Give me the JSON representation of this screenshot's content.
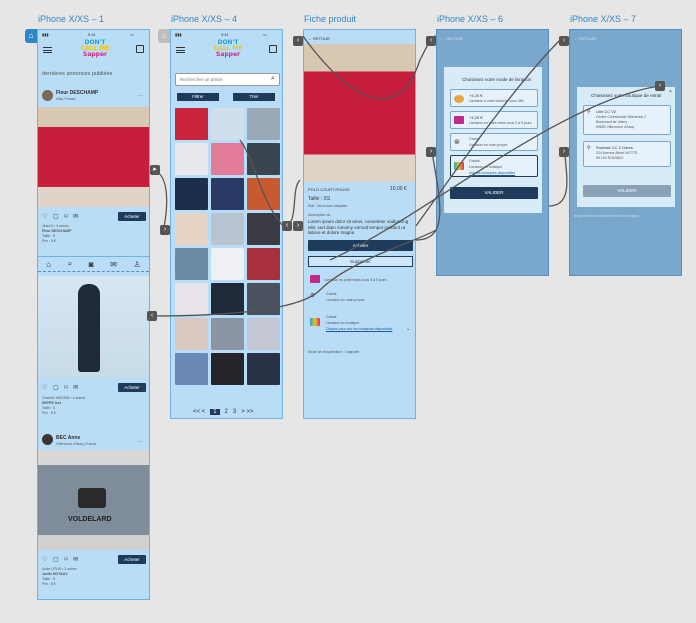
{
  "artboards": {
    "a1": "iPhone X/XS – 1",
    "a4": "iPhone X/XS – 4",
    "fp": "Fiche produit",
    "a6": "iPhone X/XS – 6",
    "a7": "iPhone X/XS – 7"
  },
  "logo": {
    "l1": "DON'T",
    "l2": "CALL ME",
    "l3": "Sapper"
  },
  "feed": {
    "heading": "dernières annonces publiées",
    "post1": {
      "name": "Fleur DESCHAMP",
      "location": "Villa, France",
      "meta1": "Jean D • 4 autres",
      "meta2": "Fleur DESCHAMP",
      "meta3": "Taille : S",
      "meta4": "Prix : 8 €",
      "buy": "Acheter"
    },
    "post2": {
      "meta1": "Charline MASSIN • 4 autres",
      "meta2": "SEPPE test",
      "meta3": "Taille : S",
      "meta4": "Prix : 8 €",
      "buy": "Acheter"
    },
    "post3": {
      "name": "BEC Anne",
      "location": "Villeneuve d'Ascq, France",
      "meta1": "Aude LEVIS • 3 autres",
      "meta2": "Joelle NOYAUX",
      "meta3": "Taille : S",
      "meta4": "Prix : 8 €",
      "buy": "Acheter",
      "print": "VOLDELARD"
    }
  },
  "catalog": {
    "search_placeholder": "Rechercher un article",
    "filter": "Filtrer",
    "sort": "Trier",
    "pager": {
      "prev": "<< <",
      "p1": "1",
      "p2": "2",
      "p3": "3",
      "next": "> >>"
    }
  },
  "product": {
    "back": "RETOUR",
    "title": "POLO COURT ROUGE",
    "price": "10,00 €",
    "size": "Taille : XS",
    "state": "Etat : Neuf avec étiquette",
    "desc_label": "Description du",
    "desc": "Lorem ipsum dolor sit amet, consetetur sadipscing elitr, sed diam nonumy eirmod tempor invidunt ut labore et dolore magna",
    "buy": "Acheter",
    "remove": "Supprimer",
    "del1": "Livraison en point relais sous 3 à 5 jours",
    "del2_title": "Gratuit",
    "del2": "Livraison en main propre",
    "del3_title": "Gratuit",
    "del3": "Livraison en boutique",
    "del3_link": "Cliquez pour voir les boutiques disponibles",
    "mode": "Mode de récupération : Cagnotte"
  },
  "shipping": {
    "back": "RETOUR",
    "title": "Choisissez votre mode de livraison",
    "o1_price": "+4,20 €",
    "o1": "Livraison à votre domicile sous 48h",
    "o2_price": "+4,20 €",
    "o2": "Livraison en point relais sous 3 à 5 jours",
    "o3_title": "Gratuit",
    "o3": "Livraison en main propre",
    "o4_title": "Gratuit",
    "o4": "Livraison en boutique",
    "o4_link": "Voir les boutiques disponibles",
    "validate": "VALIDER"
  },
  "store": {
    "back": "RETOUR",
    "title": "Choisissez votre boutique de retrait",
    "s1_name": "Lille CC V2",
    "s1_a1": "Centre Commercial Villeneuve 2",
    "s1_a2": "Boulevard de Valmy",
    "s1_a3": "59650 Villeneuve d'Ascq",
    "s2_name": "Roubaix CC 2 Gares",
    "s2_a1": "224 Avenue Alfred MOTTE",
    "s2_a2": "59 100 ROUBAIX",
    "validate": "VALIDER",
    "behind": "tempor invidunt ut labore et dolore magna"
  },
  "colors": {
    "accent": "#2f86c4",
    "artboard": "#b9ddf6",
    "dark": "#1f3b5c",
    "overlay": "#7aa7cc"
  }
}
